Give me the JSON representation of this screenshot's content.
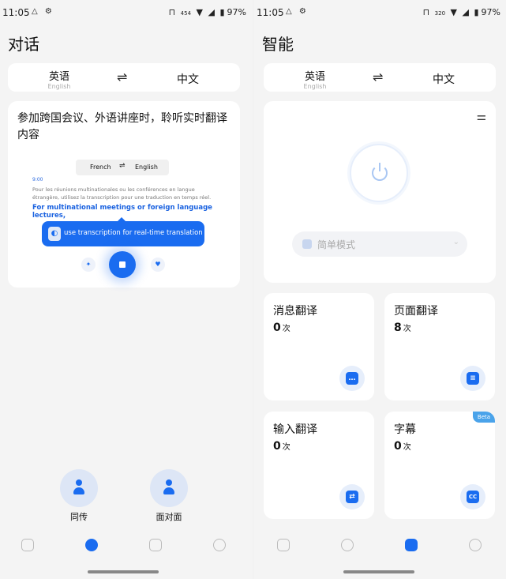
{
  "status_bar": {
    "time": "11:05",
    "left_icons": [
      "message-icon",
      "settings-icon"
    ],
    "network_speed_left": "454",
    "network_speed_right": "320",
    "battery": "97%"
  },
  "left_panel": {
    "title": "对话",
    "lang_bar": {
      "source_main": "英语",
      "source_sub": "English",
      "swap": "⇌",
      "target": "中文"
    },
    "intro_card": {
      "text": "参加跨国会议、外语讲座时，聆听实时翻译内容",
      "preview": {
        "lang_a": "French",
        "swap": "⇌",
        "lang_b": "English",
        "time": "9:00",
        "french_text": "Pour les réunions multinationales ou les conférences en langue étrangère, utilisez la transcription pour une traduction en temps réel.",
        "english_text": "For multinational meetings or foreign language lectures,",
        "tooltip": "use transcription for real-time translation"
      }
    },
    "actions": [
      {
        "label": "同传",
        "icon": "simultaneous-interpret-icon"
      },
      {
        "label": "面对面",
        "icon": "face-to-face-icon"
      }
    ],
    "nav": [
      "chat-icon",
      "interpret-icon",
      "smart-icon",
      "profile-icon"
    ]
  },
  "right_panel": {
    "title": "智能",
    "lang_bar": {
      "source_main": "英语",
      "source_sub": "English",
      "swap": "⇌",
      "target": "中文"
    },
    "mode_select": {
      "value": "简单模式"
    },
    "features": [
      {
        "title": "消息翻译",
        "count": "0",
        "unit": "次",
        "icon": "message-translate-icon",
        "glyph": "…"
      },
      {
        "title": "页面翻译",
        "count": "8",
        "unit": "次",
        "icon": "page-translate-icon",
        "glyph": "≡"
      },
      {
        "title": "输入翻译",
        "count": "0",
        "unit": "次",
        "icon": "input-translate-icon",
        "glyph": "⇄"
      },
      {
        "title": "字幕",
        "count": "0",
        "unit": "次",
        "icon": "subtitle-icon",
        "glyph": "CC",
        "badge": "Beta"
      }
    ],
    "nav": [
      "chat-icon",
      "interpret-icon",
      "smart-icon",
      "profile-icon"
    ]
  },
  "colors": {
    "accent": "#1a6cf0",
    "background": "#f4f4f4",
    "card": "#ffffff"
  }
}
